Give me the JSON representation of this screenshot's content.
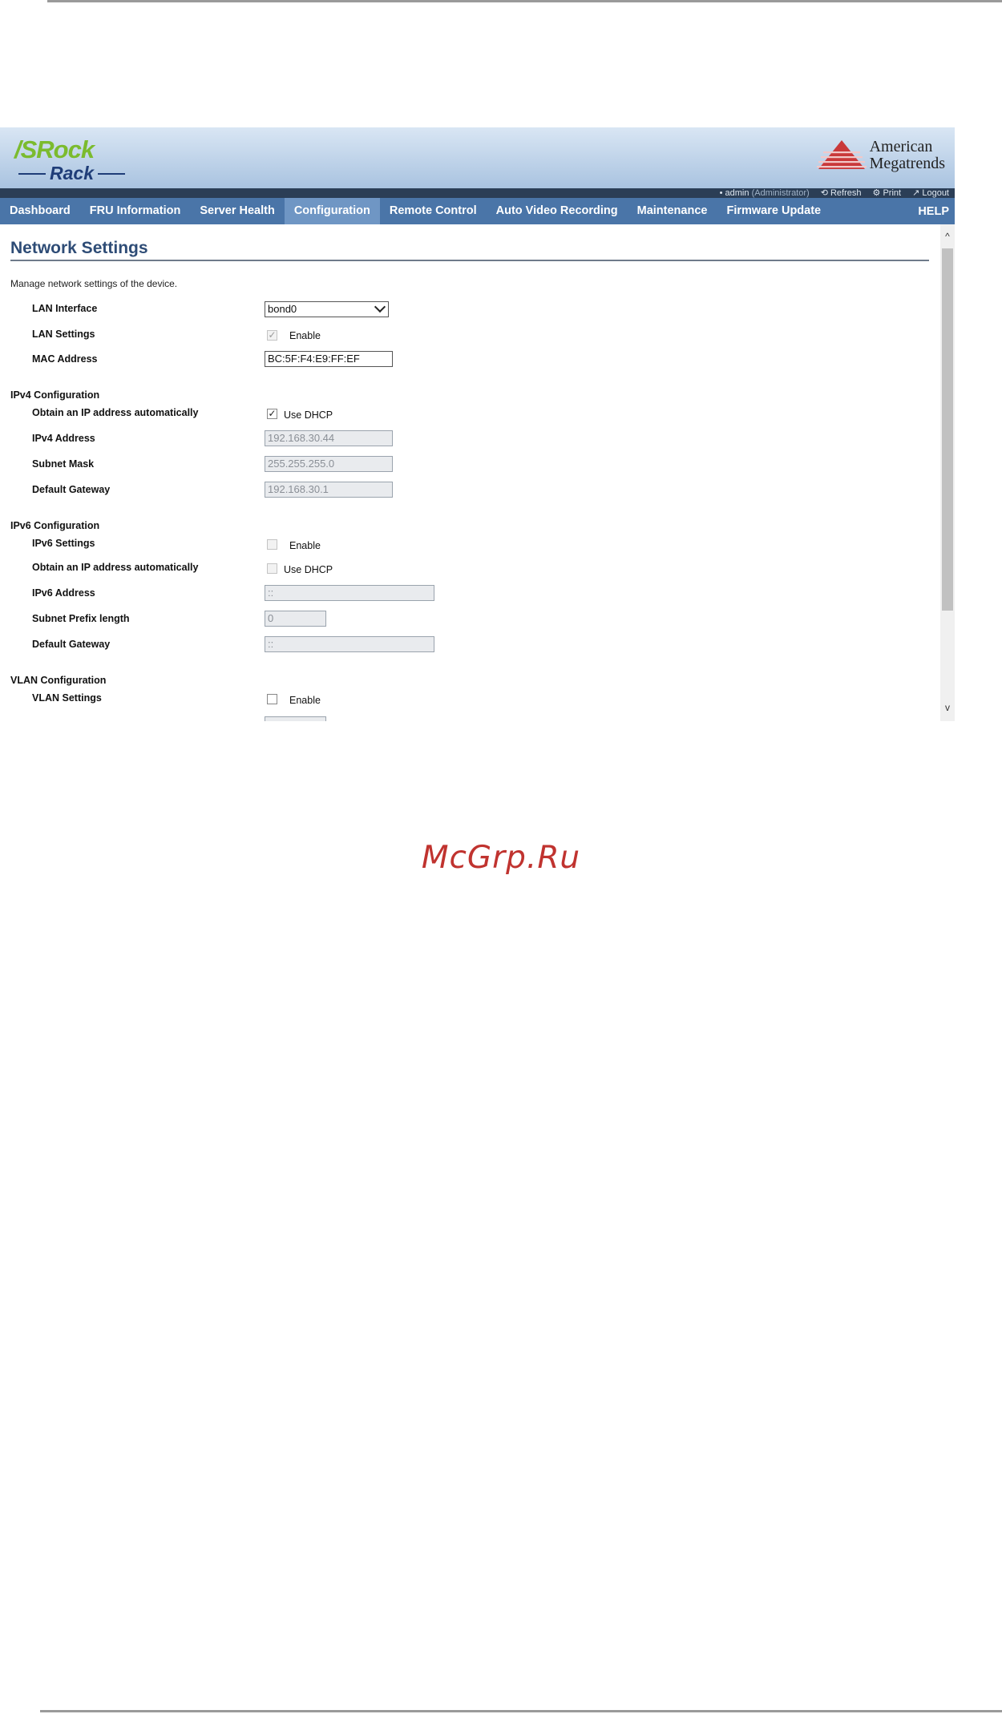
{
  "brand": {
    "logo_top": "/SRock",
    "logo_bottom": "Rack",
    "ami_line1": "American",
    "ami_line2": "Megatrends"
  },
  "userbar": {
    "user": "admin",
    "role": "(Administrator)",
    "refresh": "Refresh",
    "print": "Print",
    "logout": "Logout"
  },
  "nav": {
    "items": [
      "Dashboard",
      "FRU Information",
      "Server Health",
      "Configuration",
      "Remote Control",
      "Auto Video Recording",
      "Maintenance",
      "Firmware Update"
    ],
    "active": "Configuration",
    "help": "HELP"
  },
  "page": {
    "title": "Network Settings",
    "description": "Manage network settings of the device."
  },
  "lan": {
    "interface_label": "LAN Interface",
    "interface_value": "bond0",
    "settings_label": "LAN Settings",
    "settings_check": "Enable",
    "mac_label": "MAC Address",
    "mac_value": "BC:5F:F4:E9:FF:EF"
  },
  "ipv4": {
    "section": "IPv4 Configuration",
    "auto_label": "Obtain an IP address automatically",
    "auto_check": "Use DHCP",
    "address_label": "IPv4 Address",
    "address_value": "192.168.30.44",
    "mask_label": "Subnet Mask",
    "mask_value": "255.255.255.0",
    "gateway_label": "Default Gateway",
    "gateway_value": "192.168.30.1"
  },
  "ipv6": {
    "section": "IPv6 Configuration",
    "settings_label": "IPv6 Settings",
    "settings_check": "Enable",
    "auto_label": "Obtain an IP address automatically",
    "auto_check": "Use DHCP",
    "address_label": "IPv6 Address",
    "address_value": "::",
    "prefix_label": "Subnet Prefix length",
    "prefix_value": "0",
    "gateway_label": "Default Gateway",
    "gateway_value": "::"
  },
  "vlan": {
    "section": "VLAN Configuration",
    "settings_label": "VLAN Settings",
    "settings_check": "Enable"
  },
  "watermark": "McGrp.Ru"
}
